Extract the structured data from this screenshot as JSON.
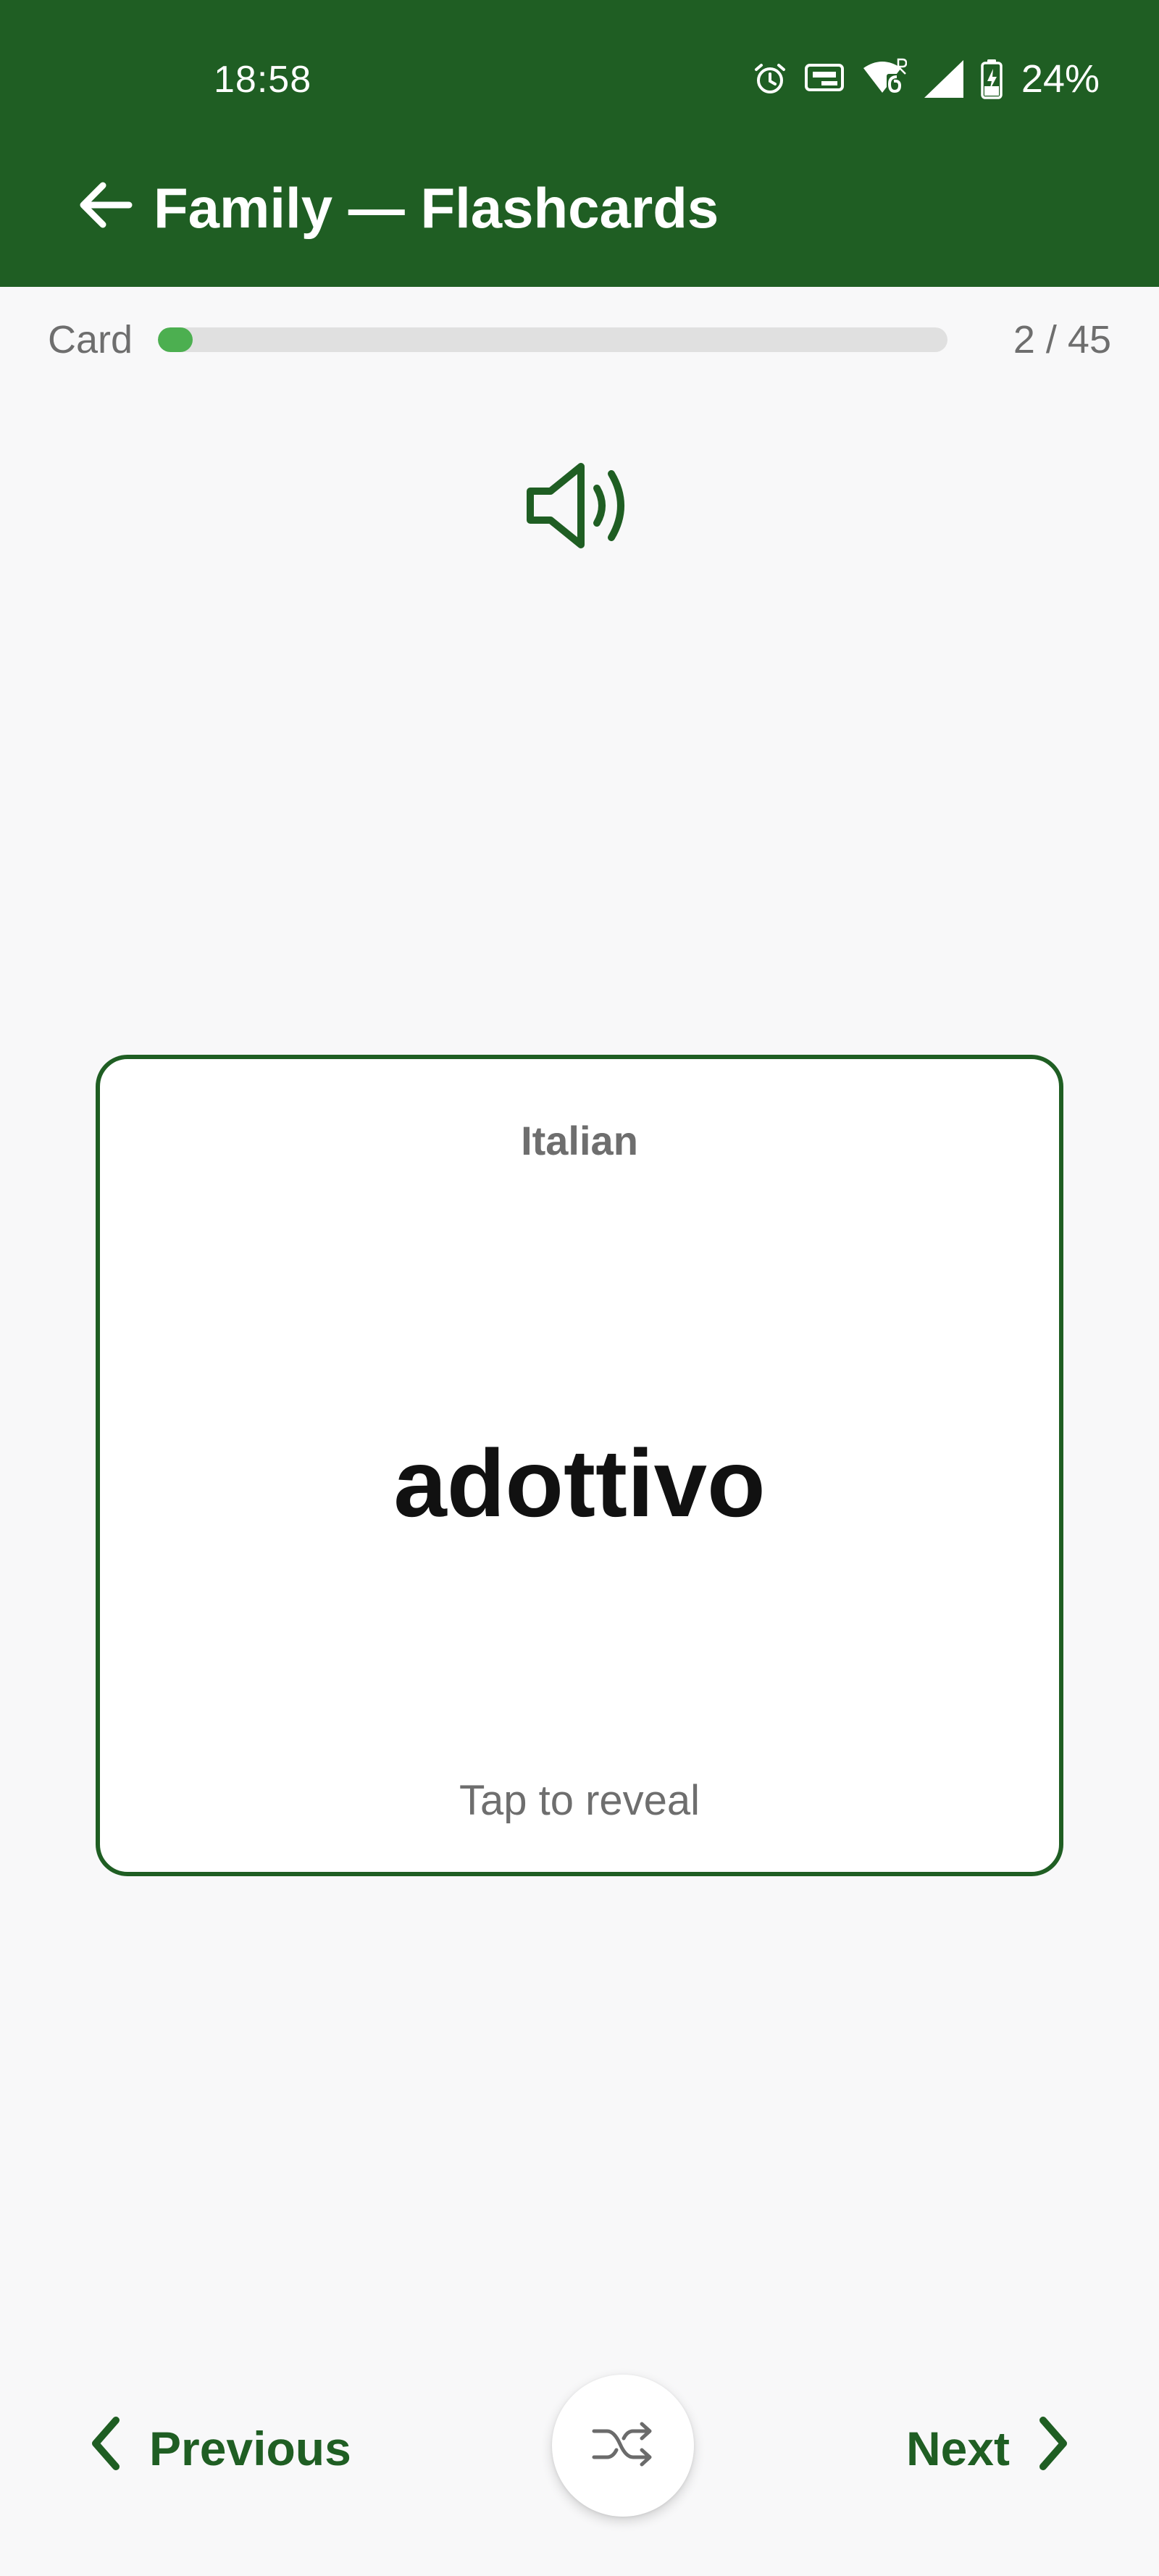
{
  "status_bar": {
    "time": "18:58",
    "battery_percent": "24%",
    "icons": [
      "alarm-icon",
      "auto-hz-icon",
      "wifi-6-icon",
      "signal-icon",
      "battery-charging-icon"
    ]
  },
  "header": {
    "title": "Family — Flashcards",
    "back_icon": "arrow-left-icon",
    "background_color": "#1f5e23"
  },
  "progress": {
    "label": "Card",
    "current": 2,
    "total": 45,
    "counter_text": "2 / 45",
    "fill_color": "#4caf50"
  },
  "audio": {
    "icon": "speaker-icon"
  },
  "card": {
    "language_label": "Italian",
    "word": "adottivo",
    "hint": "Tap to reveal",
    "border_color": "#1f5e23"
  },
  "footer": {
    "previous_label": "Previous",
    "next_label": "Next",
    "shuffle_icon": "shuffle-icon"
  }
}
